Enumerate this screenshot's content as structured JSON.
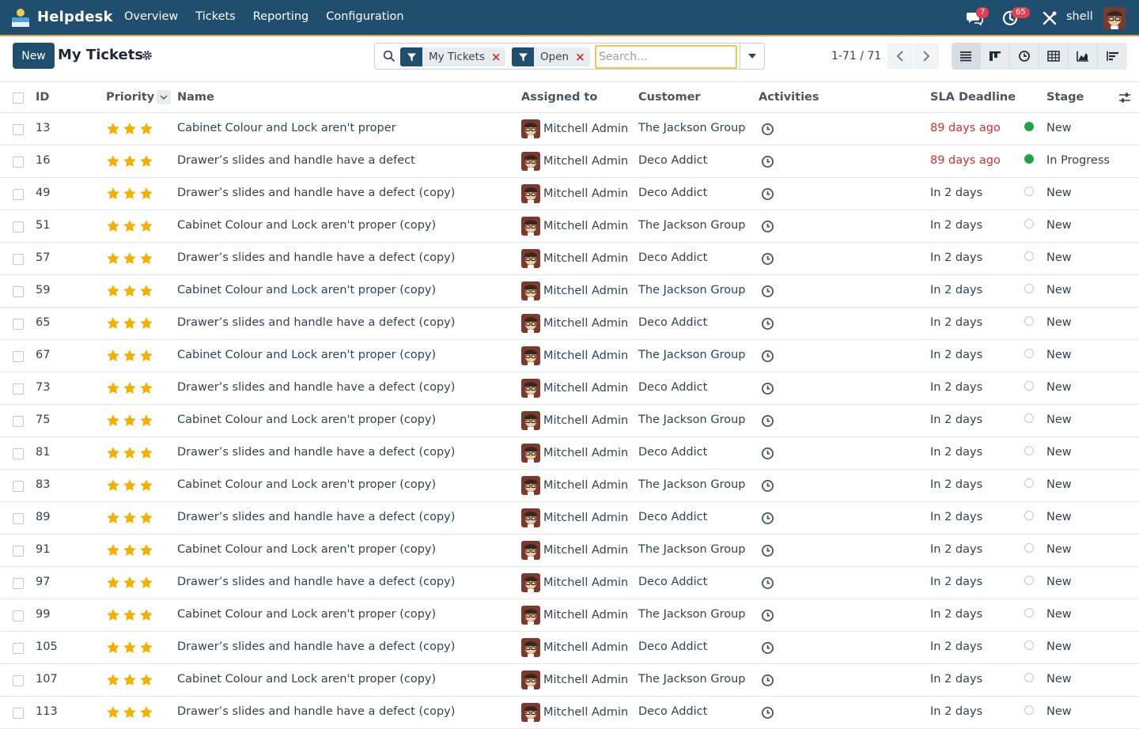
{
  "navbar": {
    "app_name": "Helpdesk",
    "menu": [
      "Overview",
      "Tickets",
      "Reporting",
      "Configuration"
    ],
    "messages_count": "7",
    "activities_count": "65",
    "user_name": "shell",
    "colors": {
      "bar": "#1f4e6e",
      "accent": "#e8a33c",
      "badge": "#e0404f"
    }
  },
  "control_panel": {
    "new_label": "New",
    "title": "My Tickets",
    "facets": [
      "My Tickets",
      "Open"
    ],
    "search_placeholder": "Search...",
    "pager": "1-71 / 71",
    "views": [
      "list-view-icon",
      "kanban-view-icon",
      "activity-view-icon",
      "pivot-view-icon",
      "graph-view-icon",
      "cohort-view-icon"
    ]
  },
  "table": {
    "columns": [
      "ID",
      "Priority",
      "Name",
      "Assigned to",
      "Customer",
      "Activities",
      "SLA Deadline",
      "Stage"
    ],
    "rows": [
      {
        "id": "13",
        "stars": 3,
        "name": "Cabinet Colour and Lock aren't proper",
        "assigned": "Mitchell Admin",
        "customer": "The Jackson Group",
        "sla": "89 days ago",
        "sla_overdue": true,
        "status": "green",
        "stage": "New"
      },
      {
        "id": "16",
        "stars": 3,
        "name": "Drawer’s slides and handle have a defect",
        "assigned": "Mitchell Admin",
        "customer": "Deco Addict",
        "sla": "89 days ago",
        "sla_overdue": true,
        "status": "green",
        "stage": "In Progress"
      },
      {
        "id": "49",
        "stars": 3,
        "name": "Drawer’s slides and handle have a defect (copy)",
        "assigned": "Mitchell Admin",
        "customer": "Deco Addict",
        "sla": "In 2 days",
        "sla_overdue": false,
        "status": "none",
        "stage": "New"
      },
      {
        "id": "51",
        "stars": 3,
        "name": "Cabinet Colour and Lock aren't proper (copy)",
        "assigned": "Mitchell Admin",
        "customer": "The Jackson Group",
        "sla": "In 2 days",
        "sla_overdue": false,
        "status": "none",
        "stage": "New"
      },
      {
        "id": "57",
        "stars": 3,
        "name": "Drawer’s slides and handle have a defect (copy)",
        "assigned": "Mitchell Admin",
        "customer": "Deco Addict",
        "sla": "In 2 days",
        "sla_overdue": false,
        "status": "none",
        "stage": "New"
      },
      {
        "id": "59",
        "stars": 3,
        "name": "Cabinet Colour and Lock aren't proper (copy)",
        "assigned": "Mitchell Admin",
        "customer": "The Jackson Group",
        "sla": "In 2 days",
        "sla_overdue": false,
        "status": "none",
        "stage": "New"
      },
      {
        "id": "65",
        "stars": 3,
        "name": "Drawer’s slides and handle have a defect (copy)",
        "assigned": "Mitchell Admin",
        "customer": "Deco Addict",
        "sla": "In 2 days",
        "sla_overdue": false,
        "status": "none",
        "stage": "New"
      },
      {
        "id": "67",
        "stars": 3,
        "name": "Cabinet Colour and Lock aren't proper (copy)",
        "assigned": "Mitchell Admin",
        "customer": "The Jackson Group",
        "sla": "In 2 days",
        "sla_overdue": false,
        "status": "none",
        "stage": "New"
      },
      {
        "id": "73",
        "stars": 3,
        "name": "Drawer’s slides and handle have a defect (copy)",
        "assigned": "Mitchell Admin",
        "customer": "Deco Addict",
        "sla": "In 2 days",
        "sla_overdue": false,
        "status": "none",
        "stage": "New"
      },
      {
        "id": "75",
        "stars": 3,
        "name": "Cabinet Colour and Lock aren't proper (copy)",
        "assigned": "Mitchell Admin",
        "customer": "The Jackson Group",
        "sla": "In 2 days",
        "sla_overdue": false,
        "status": "none",
        "stage": "New"
      },
      {
        "id": "81",
        "stars": 3,
        "name": "Drawer’s slides and handle have a defect (copy)",
        "assigned": "Mitchell Admin",
        "customer": "Deco Addict",
        "sla": "In 2 days",
        "sla_overdue": false,
        "status": "none",
        "stage": "New"
      },
      {
        "id": "83",
        "stars": 3,
        "name": "Cabinet Colour and Lock aren't proper (copy)",
        "assigned": "Mitchell Admin",
        "customer": "The Jackson Group",
        "sla": "In 2 days",
        "sla_overdue": false,
        "status": "none",
        "stage": "New"
      },
      {
        "id": "89",
        "stars": 3,
        "name": "Drawer’s slides and handle have a defect (copy)",
        "assigned": "Mitchell Admin",
        "customer": "Deco Addict",
        "sla": "In 2 days",
        "sla_overdue": false,
        "status": "none",
        "stage": "New"
      },
      {
        "id": "91",
        "stars": 3,
        "name": "Cabinet Colour and Lock aren't proper (copy)",
        "assigned": "Mitchell Admin",
        "customer": "The Jackson Group",
        "sla": "In 2 days",
        "sla_overdue": false,
        "status": "none",
        "stage": "New"
      },
      {
        "id": "97",
        "stars": 3,
        "name": "Drawer’s slides and handle have a defect (copy)",
        "assigned": "Mitchell Admin",
        "customer": "Deco Addict",
        "sla": "In 2 days",
        "sla_overdue": false,
        "status": "none",
        "stage": "New"
      },
      {
        "id": "99",
        "stars": 3,
        "name": "Cabinet Colour and Lock aren't proper (copy)",
        "assigned": "Mitchell Admin",
        "customer": "The Jackson Group",
        "sla": "In 2 days",
        "sla_overdue": false,
        "status": "none",
        "stage": "New"
      },
      {
        "id": "105",
        "stars": 3,
        "name": "Drawer’s slides and handle have a defect (copy)",
        "assigned": "Mitchell Admin",
        "customer": "Deco Addict",
        "sla": "In 2 days",
        "sla_overdue": false,
        "status": "none",
        "stage": "New"
      },
      {
        "id": "107",
        "stars": 3,
        "name": "Cabinet Colour and Lock aren't proper (copy)",
        "assigned": "Mitchell Admin",
        "customer": "The Jackson Group",
        "sla": "In 2 days",
        "sla_overdue": false,
        "status": "none",
        "stage": "New"
      },
      {
        "id": "113",
        "stars": 3,
        "name": "Drawer’s slides and handle have a defect (copy)",
        "assigned": "Mitchell Admin",
        "customer": "Deco Addict",
        "sla": "In 2 days",
        "sla_overdue": false,
        "status": "none",
        "stage": "New"
      }
    ],
    "colors": {
      "star": "#f3b000",
      "overdue": "#d0312d",
      "status_green": "#21a34a"
    }
  }
}
